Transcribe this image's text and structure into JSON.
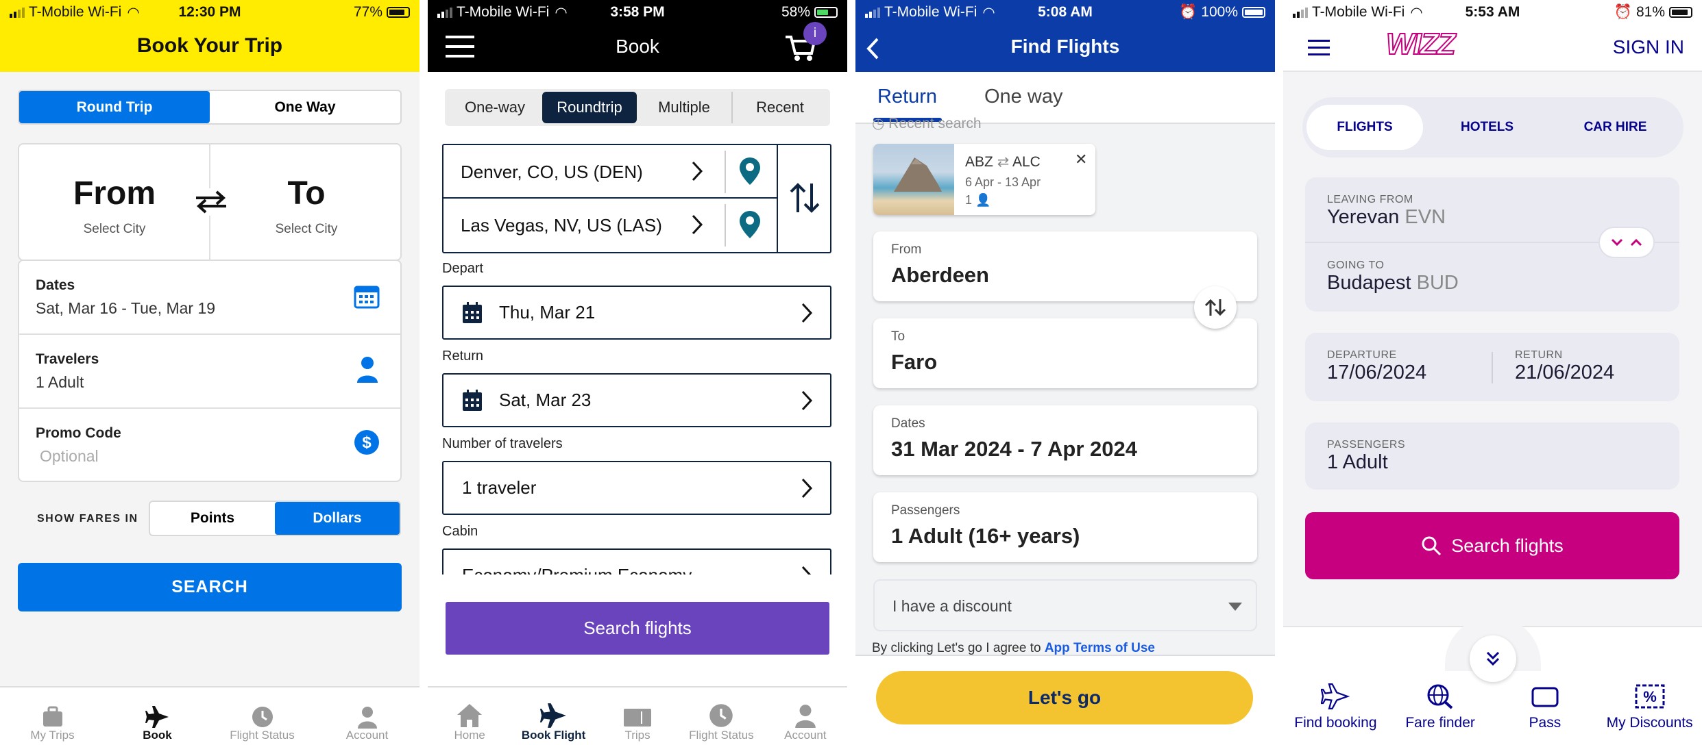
{
  "panel1": {
    "status": {
      "carrier": "T-Mobile Wi-Fi",
      "time": "12:30 PM",
      "battery": "77%",
      "battery_level": 0.77
    },
    "title": "Book Your Trip",
    "trip_tabs": [
      "Round Trip",
      "One Way"
    ],
    "from_label": "From",
    "from_sub": "Select City",
    "to_label": "To",
    "to_sub": "Select City",
    "dates_label": "Dates",
    "dates_value": "Sat, Mar 16 - Tue, Mar 19",
    "travelers_label": "Travelers",
    "travelers_value": "1 Adult",
    "promo_label": "Promo Code",
    "promo_placeholder": "Optional",
    "fares_label": "SHOW FARES IN",
    "fares_options": [
      "Points",
      "Dollars"
    ],
    "search_label": "SEARCH",
    "nav": [
      "My Trips",
      "Book",
      "Flight Status",
      "Account"
    ],
    "colors": {
      "header": "#ffec00",
      "accent": "#0073e6"
    }
  },
  "panel2": {
    "status": {
      "carrier": "T-Mobile Wi-Fi",
      "time": "3:58 PM",
      "battery": "58%",
      "battery_level": 0.58
    },
    "title": "Book",
    "cart_badge": "i",
    "tabs": [
      "One-way",
      "Roundtrip",
      "Multiple",
      "Recent"
    ],
    "origin": "Denver, CO, US (DEN)",
    "destination": "Las Vegas, NV, US (LAS)",
    "depart_label": "Depart",
    "depart_value": "Thu, Mar 21",
    "return_label": "Return",
    "return_value": "Sat, Mar 23",
    "travelers_label": "Number of travelers",
    "travelers_value": "1 traveler",
    "cabin_label": "Cabin",
    "cabin_value": "Economy/Premium Economy",
    "search_label": "Search flights",
    "nav": [
      "Home",
      "Book Flight",
      "Trips",
      "Flight Status",
      "Account"
    ],
    "colors": {
      "accent": "#6a44bd",
      "navy": "#0e2340",
      "teal": "#0c6b83"
    }
  },
  "panel3": {
    "status": {
      "carrier": "T-Mobile Wi-Fi",
      "time": "5:08 AM",
      "battery": "100%",
      "battery_level": 1.0
    },
    "title": "Find Flights",
    "tabs": [
      "Return",
      "One way"
    ],
    "recent_label": "Recent search",
    "recent": {
      "route_from": "ABZ",
      "route_to": "ALC",
      "dates": "6 Apr - 13 Apr",
      "pax": "1"
    },
    "from_caption": "From",
    "from_value": "Aberdeen",
    "to_caption": "To",
    "to_value": "Faro",
    "dates_caption": "Dates",
    "dates_value": "31 Mar 2024 - 7 Apr 2024",
    "passengers_caption": "Passengers",
    "passengers_value": "1 Adult (16+ years)",
    "discount_label": "I have a discount",
    "terms_text": "By clicking Let's go I agree to",
    "terms_link": "App Terms of Use",
    "go_label": "Let's go",
    "colors": {
      "header": "#0c3ca8",
      "button": "#f4c430"
    }
  },
  "panel4": {
    "status": {
      "carrier": "T-Mobile Wi-Fi",
      "time": "5:53 AM",
      "battery": "81%",
      "battery_level": 0.81
    },
    "logo": "WIZZ",
    "sign_in": "SIGN IN",
    "tabs": [
      "FLIGHTS",
      "HOTELS",
      "CAR HIRE"
    ],
    "leaving_label": "LEAVING FROM",
    "leaving_city": "Yerevan",
    "leaving_code": "EVN",
    "going_label": "GOING TO",
    "going_city": "Budapest",
    "going_code": "BUD",
    "departure_label": "DEPARTURE",
    "departure_value": "17/06/2024",
    "return_label": "RETURN",
    "return_value": "21/06/2024",
    "passengers_label": "PASSENGERS",
    "passengers_value": "1 Adult",
    "search_label": "Search flights",
    "nav": [
      "Find booking",
      "Fare finder",
      "Pass",
      "My Discounts"
    ],
    "colors": {
      "brand": "#c6007e",
      "navy": "#06038d"
    }
  }
}
